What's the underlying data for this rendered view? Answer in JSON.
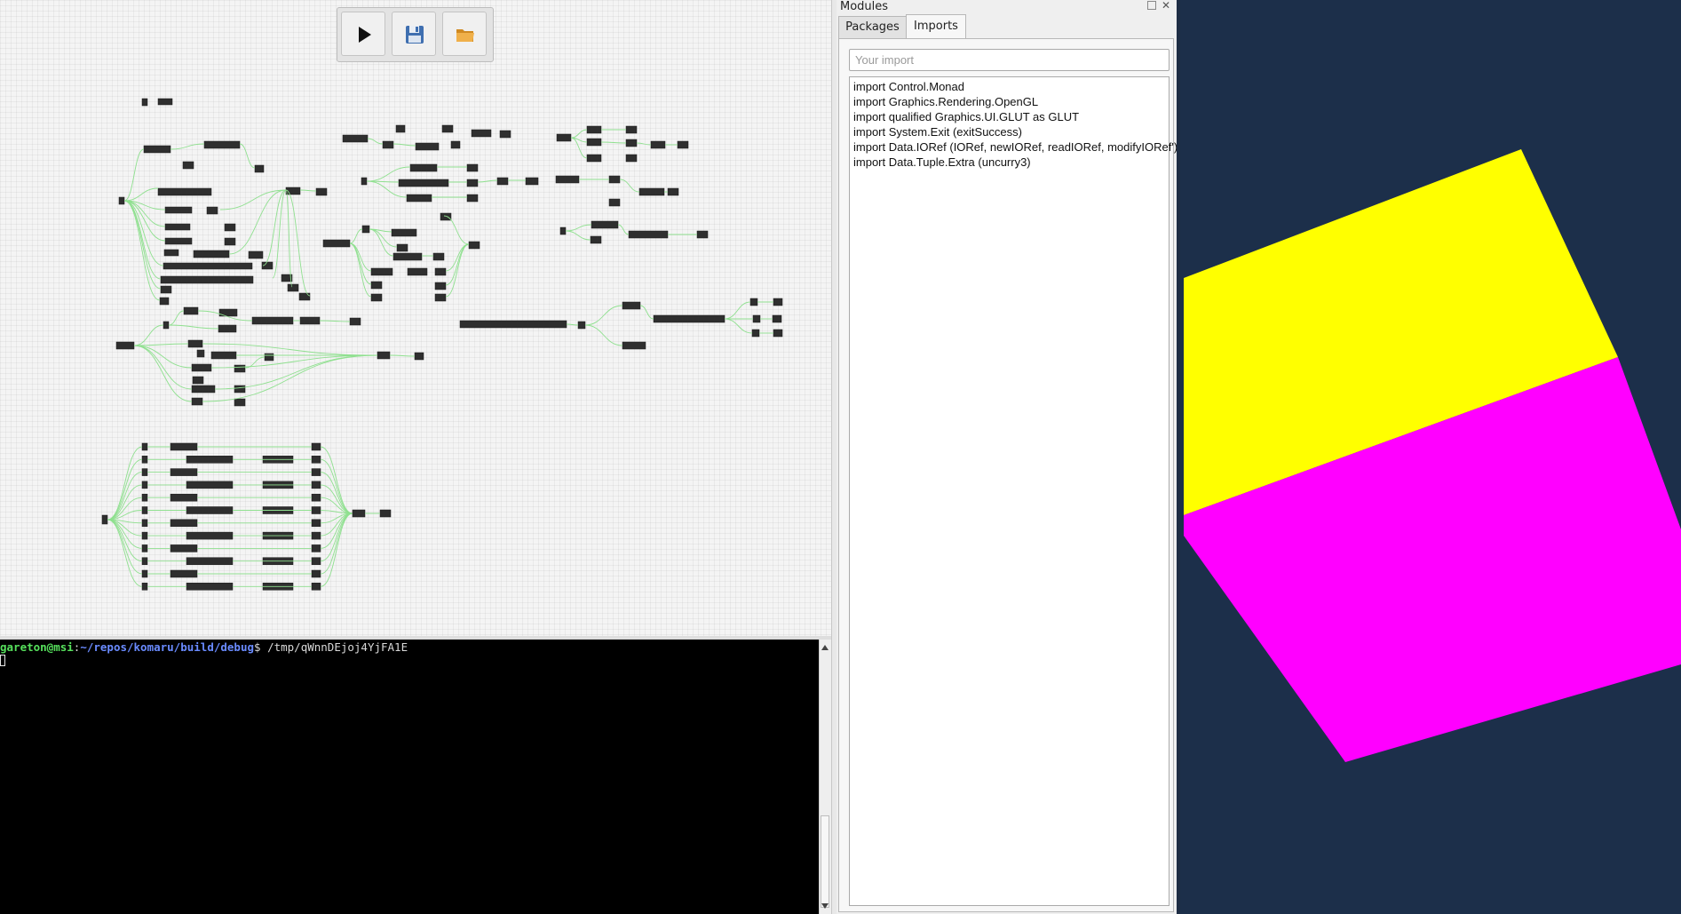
{
  "toolbar": {
    "run_icon": "play-icon",
    "save_icon": "floppy-disk-icon",
    "open_icon": "open-folder-icon"
  },
  "terminal": {
    "user_host": "gareton@msi",
    "separator": ":",
    "path": "~/repos/komaru/build/debug",
    "prompt_symbol": "$",
    "command": "/tmp/qWnnDEjoj4YjFA1E"
  },
  "modules_panel": {
    "title": "Modules",
    "tabs": [
      {
        "label": "Packages",
        "active": false
      },
      {
        "label": "Imports",
        "active": true
      }
    ],
    "import_input": {
      "placeholder": "Your import",
      "value": ""
    },
    "imports": [
      "import Control.Monad",
      "import Graphics.Rendering.OpenGL",
      "import qualified Graphics.UI.GLUT as GLUT",
      "import System.Exit (exitSuccess)",
      "import Data.IORef (IORef, newIORef, readIORef, modifyIORef')",
      "import Data.Tuple.Extra (uncurry3)"
    ]
  },
  "gl_window": {
    "background": "#1c2f4a",
    "faces": [
      {
        "name": "top-face",
        "color": "#ffff00"
      },
      {
        "name": "front-face",
        "color": "#ff00ff"
      }
    ]
  },
  "colors": {
    "wire": "#8fe08f",
    "node": "#2f2f2f",
    "terminal_bg": "#000000",
    "prompt_user": "#56e05c",
    "prompt_path": "#6a8bff"
  }
}
